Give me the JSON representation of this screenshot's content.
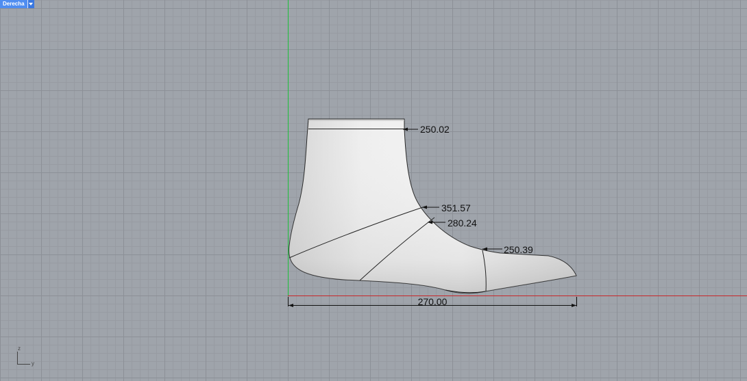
{
  "viewport": {
    "name": "Derecha",
    "menu_icon": "chevron-down-icon"
  },
  "colors": {
    "grid_background": "#9fa4ab",
    "y_axis": "#1bbf3a",
    "x_axis": "#c8262a",
    "model_fill": "#e6e6e6",
    "model_edge": "#222222"
  },
  "dimensions": {
    "top_girth": "250.02",
    "instep_girth": "351.57",
    "waist_girth": "280.24",
    "ball_girth": "250.39",
    "length": "270.00"
  },
  "axis_icon": {
    "vertical": "z",
    "horizontal": "y"
  }
}
